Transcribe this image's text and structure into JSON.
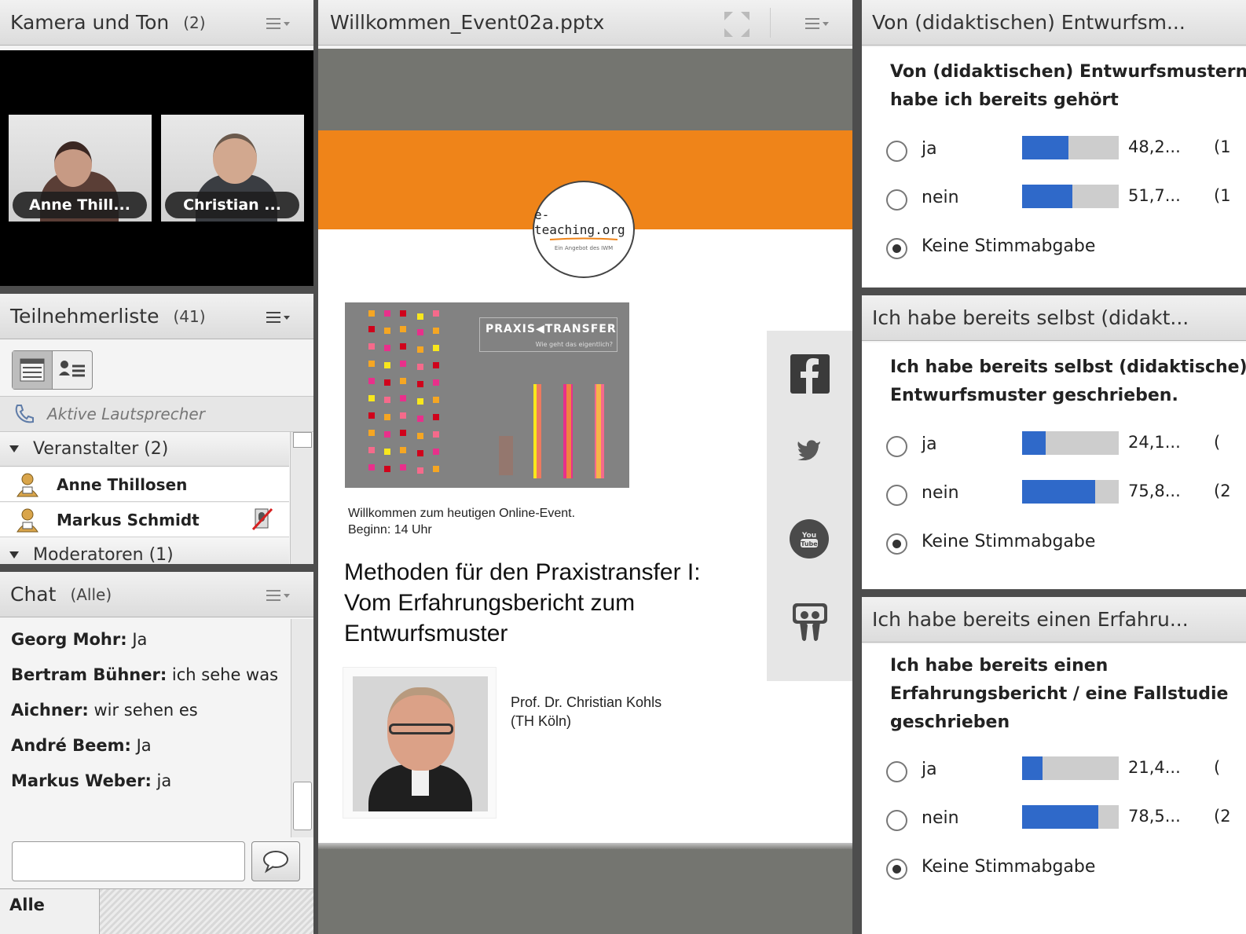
{
  "camera_pod": {
    "title": "Kamera und Ton",
    "count": "(2)",
    "tiles": [
      {
        "name": "Anne Thill..."
      },
      {
        "name": "Christian ..."
      }
    ]
  },
  "attendee_pod": {
    "title": "Teilnehmerliste",
    "count": "(41)",
    "active_speakers": "Aktive Lautsprecher",
    "groups": [
      {
        "label": "Veranstalter (2)",
        "members": [
          "Anne Thillosen",
          "Markus Schmidt"
        ]
      },
      {
        "label": "Moderatoren (1)"
      }
    ]
  },
  "chat_pod": {
    "title": "Chat",
    "scope": "(Alle)",
    "messages": [
      {
        "sender": "Georg Mohr:",
        "text": "Ja"
      },
      {
        "sender": "Bertram Bühner:",
        "text": "ich sehe was"
      },
      {
        "sender": "Aichner:",
        "text": "wir sehen es"
      },
      {
        "sender": "André Beem:",
        "text": "Ja"
      },
      {
        "sender": "Markus Weber:",
        "text": "ja"
      }
    ],
    "input_value": "",
    "recipient_tab": "Alle"
  },
  "share_pod": {
    "title": "Willkommen_Event02a.pptx",
    "slide": {
      "logo_text": "e-teaching.org",
      "logo_subtext": "Ein Angebot des IWM",
      "teaser_title": "PRAXIS◀TRANSFER",
      "teaser_subtitle": "Wie geht das eigentlich?",
      "welcome_line1": "Willkommen zum heutigen Online-Event.",
      "welcome_line2": "Beginn: 14 Uhr",
      "title_line1": "Methoden für den Praxistransfer I:",
      "title_line2": "Vom Erfahrungsbericht zum",
      "title_line3": "Entwurfsmuster",
      "speaker_line1": "Prof. Dr. Christian Kohls",
      "speaker_line2": "(TH Köln)",
      "social_icons": [
        "facebook-icon",
        "twitter-icon",
        "youtube-icon",
        "slideshare-icon"
      ]
    }
  },
  "polls": [
    {
      "header": "Von (didaktischen) Entwurfsm...",
      "question_lines": [
        "Von (didaktischen) Entwurfsmustern",
        "habe ich bereits gehört"
      ],
      "options": [
        {
          "label": "ja",
          "percent_text": "48,2...",
          "count_text": "(1",
          "fraction": 0.482
        },
        {
          "label": "nein",
          "percent_text": "51,7...",
          "count_text": "(1",
          "fraction": 0.517
        }
      ],
      "no_vote_label": "Keine Stimmabgabe"
    },
    {
      "header": "Ich habe bereits selbst (didakt...",
      "question_lines": [
        "Ich habe bereits selbst (didaktische)",
        "Entwurfsmuster geschrieben."
      ],
      "options": [
        {
          "label": "ja",
          "percent_text": "24,1...",
          "count_text": "(",
          "fraction": 0.241
        },
        {
          "label": "nein",
          "percent_text": "75,8...",
          "count_text": "(2",
          "fraction": 0.758
        }
      ],
      "no_vote_label": "Keine Stimmabgabe"
    },
    {
      "header": "Ich habe bereits einen Erfahru...",
      "question_lines": [
        "Ich habe bereits einen",
        "Erfahrungsbericht / eine Fallstudie",
        "geschrieben"
      ],
      "options": [
        {
          "label": "ja",
          "percent_text": "21,4...",
          "count_text": "(",
          "fraction": 0.214
        },
        {
          "label": "nein",
          "percent_text": "78,5...",
          "count_text": "(2",
          "fraction": 0.785
        }
      ],
      "no_vote_label": "Keine Stimmabgabe"
    }
  ],
  "colors": {
    "poll_bar": "#2f69c9",
    "slide_orange": "#ef8419",
    "pod_background": "#f4f4f4"
  }
}
